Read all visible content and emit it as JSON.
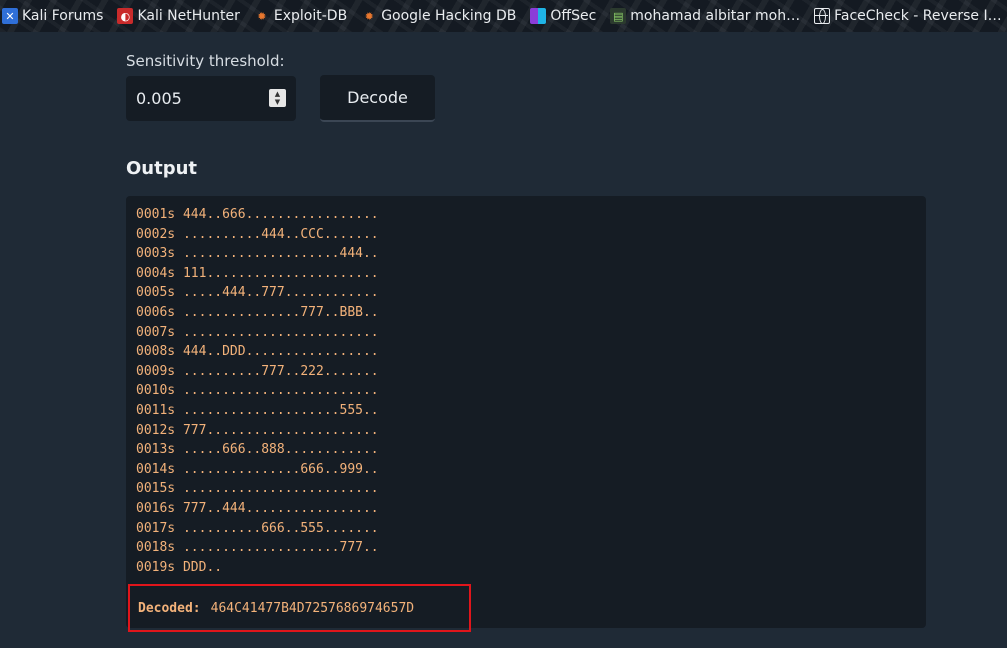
{
  "bookmarks": [
    {
      "label": "Kali Forums",
      "icon": "kali-forums-icon"
    },
    {
      "label": "Kali NetHunter",
      "icon": "kali-nethunter-icon"
    },
    {
      "label": "Exploit-DB",
      "icon": "exploit-db-icon"
    },
    {
      "label": "Google Hacking DB",
      "icon": "google-hacking-db-icon"
    },
    {
      "label": "OffSec",
      "icon": "offsec-icon"
    },
    {
      "label": "mohamad albitar moh…",
      "icon": "profile-icon"
    },
    {
      "label": "FaceCheck - Reverse I…",
      "icon": "globe-icon"
    }
  ],
  "form": {
    "sensitivity_label": "Sensitivity threshold:",
    "sensitivity_value": "0.005",
    "decode_label": "Decode"
  },
  "output": {
    "title": "Output",
    "lines": [
      "0001s 444..666.................",
      "0002s ..........444..CCC.......",
      "0003s ....................444..",
      "0004s 111......................",
      "0005s .....444..777............",
      "0006s ...............777..BBB..",
      "0007s .........................",
      "0008s 444..DDD.................",
      "0009s ..........777..222.......",
      "0010s .........................",
      "0011s ....................555..",
      "0012s 777......................",
      "0013s .....666..888............",
      "0014s ...............666..999..",
      "0015s .........................",
      "0016s 777..444.................",
      "0017s ..........666..555.......",
      "0018s ....................777..",
      "0019s DDD.."
    ],
    "decoded_label": "Decoded:",
    "decoded_value": "464C41477B4D7257686974657D"
  },
  "colors": {
    "background": "#1f2a36",
    "panel": "#151c24",
    "output_text": "#f3b27a",
    "highlight_border": "#e0151b"
  }
}
